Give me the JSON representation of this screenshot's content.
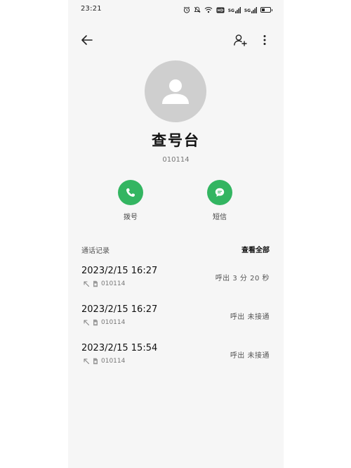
{
  "status_bar": {
    "time": "23:21",
    "signal_1": "5G",
    "signal_2": "5G"
  },
  "contact": {
    "name": "查号台",
    "number": "010114"
  },
  "actions": {
    "call_label": "拨号",
    "message_label": "短信"
  },
  "call_log": {
    "title": "通话记录",
    "view_all": "查看全部",
    "entries": [
      {
        "datetime": "2023/2/15 16:27",
        "number": "010114",
        "status": "呼出 3 分 20 秒"
      },
      {
        "datetime": "2023/2/15 16:27",
        "number": "010114",
        "status": "呼出 未接通"
      },
      {
        "datetime": "2023/2/15 15:54",
        "number": "010114",
        "status": "呼出 未接通"
      }
    ]
  },
  "colors": {
    "accent_green": "#33b561",
    "background": "#f6f6f6",
    "avatar_gray": "#cfcfcf"
  }
}
